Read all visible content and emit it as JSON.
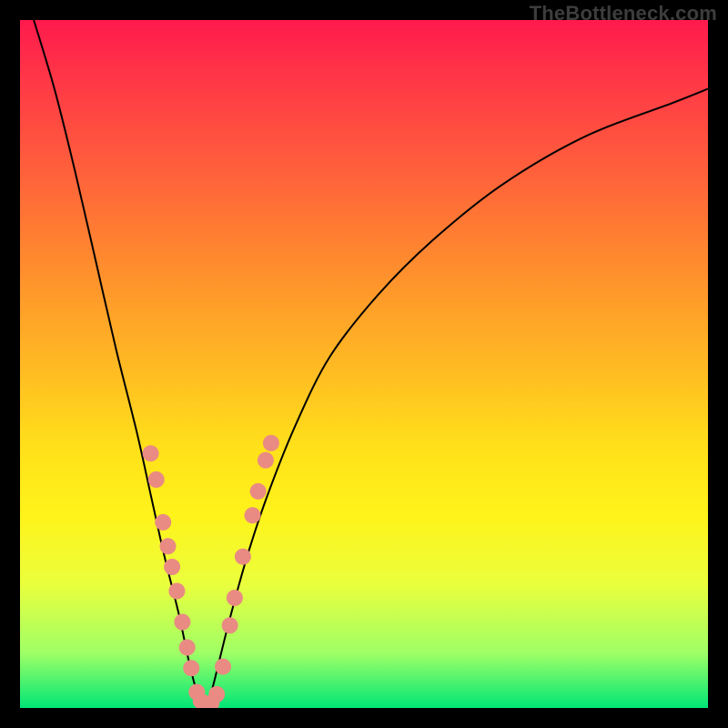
{
  "watermark": "TheBottleneck.com",
  "colors": {
    "frame": "#000000",
    "gradient_top": "#ff1a4d",
    "gradient_bottom": "#00e676",
    "curve": "#000000",
    "dots": "#e98b83"
  },
  "chart_data": {
    "type": "line",
    "title": "",
    "xlabel": "",
    "ylabel": "",
    "xlim": [
      0,
      100
    ],
    "ylim": [
      0,
      100
    ],
    "grid": false,
    "legend": false,
    "note": "Axes are unlabeled; x is normalized horizontal position 0–100, y is normalized vertical value 0–100 (0 at bottom green band, 100 at top red band). Values estimated from pixel positions.",
    "series": [
      {
        "name": "bottleneck-curve",
        "x": [
          2,
          5,
          8,
          11,
          14,
          17,
          19,
          21,
          23,
          24.5,
          25.5,
          26.2,
          26.8,
          27.3,
          28,
          29,
          30.5,
          33,
          36,
          40,
          45,
          52,
          60,
          70,
          82,
          95,
          100
        ],
        "y": [
          100,
          90,
          78,
          65,
          52,
          40,
          31,
          22,
          14,
          7,
          3,
          1,
          0.5,
          1,
          3,
          7,
          13,
          22,
          31,
          41,
          51,
          60,
          68,
          76,
          83,
          88,
          90
        ]
      }
    ],
    "dots": {
      "name": "highlighted-points",
      "points": [
        {
          "x": 19.0,
          "y": 37.0
        },
        {
          "x": 19.8,
          "y": 33.2
        },
        {
          "x": 20.8,
          "y": 27.0
        },
        {
          "x": 21.5,
          "y": 23.5
        },
        {
          "x": 22.1,
          "y": 20.5
        },
        {
          "x": 22.8,
          "y": 17.0
        },
        {
          "x": 23.6,
          "y": 12.5
        },
        {
          "x": 24.3,
          "y": 8.8
        },
        {
          "x": 24.9,
          "y": 5.8
        },
        {
          "x": 25.7,
          "y": 2.3
        },
        {
          "x": 26.3,
          "y": 1.0
        },
        {
          "x": 27.0,
          "y": 0.5
        },
        {
          "x": 27.8,
          "y": 0.7
        },
        {
          "x": 28.6,
          "y": 2.0
        },
        {
          "x": 29.5,
          "y": 6.0
        },
        {
          "x": 30.5,
          "y": 12.0
        },
        {
          "x": 31.2,
          "y": 16.0
        },
        {
          "x": 32.4,
          "y": 22.0
        },
        {
          "x": 33.8,
          "y": 28.0
        },
        {
          "x": 34.6,
          "y": 31.5
        },
        {
          "x": 35.7,
          "y": 36.0
        },
        {
          "x": 36.5,
          "y": 38.5
        }
      ]
    }
  }
}
